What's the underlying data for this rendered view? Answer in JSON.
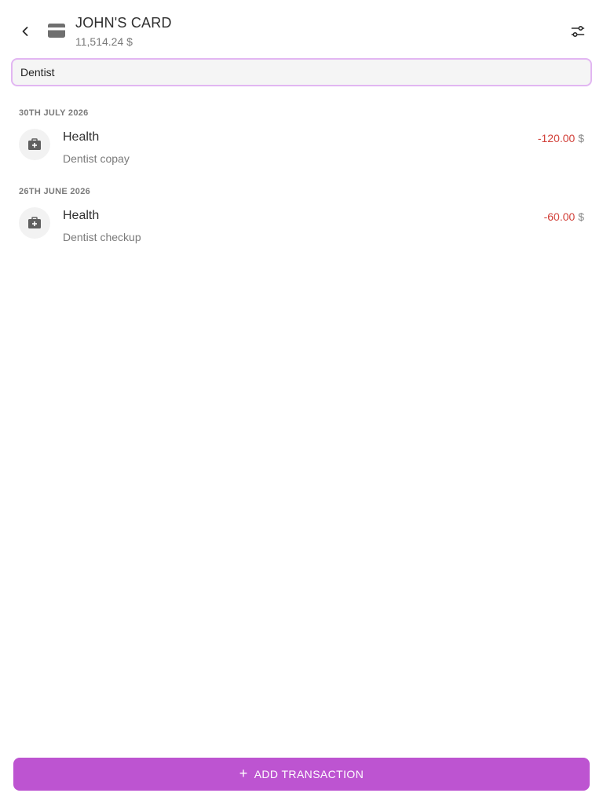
{
  "header": {
    "title": "JOHN'S CARD",
    "balance": "11,514.24 $",
    "back_icon": "chevron-left-icon",
    "account_icon": "credit-card-icon",
    "filter_icon": "tune-sliders-icon"
  },
  "search": {
    "value": "Dentist",
    "placeholder": ""
  },
  "groups": [
    {
      "date": "30TH JULY 2026",
      "transactions": [
        {
          "category": "Health",
          "note": "Dentist copay",
          "amount": "-120.00",
          "currency": "$",
          "icon": "medical-bag-icon"
        }
      ]
    },
    {
      "date": "26TH JUNE 2026",
      "transactions": [
        {
          "category": "Health",
          "note": "Dentist checkup",
          "amount": "-60.00",
          "currency": "$",
          "icon": "medical-bag-icon"
        }
      ]
    }
  ],
  "footer": {
    "add_label": "ADD TRANSACTION",
    "add_icon": "plus-icon"
  },
  "colors": {
    "accent": "#bd54d1",
    "search_border": "#e2b6f2",
    "negative": "#d2413a"
  }
}
